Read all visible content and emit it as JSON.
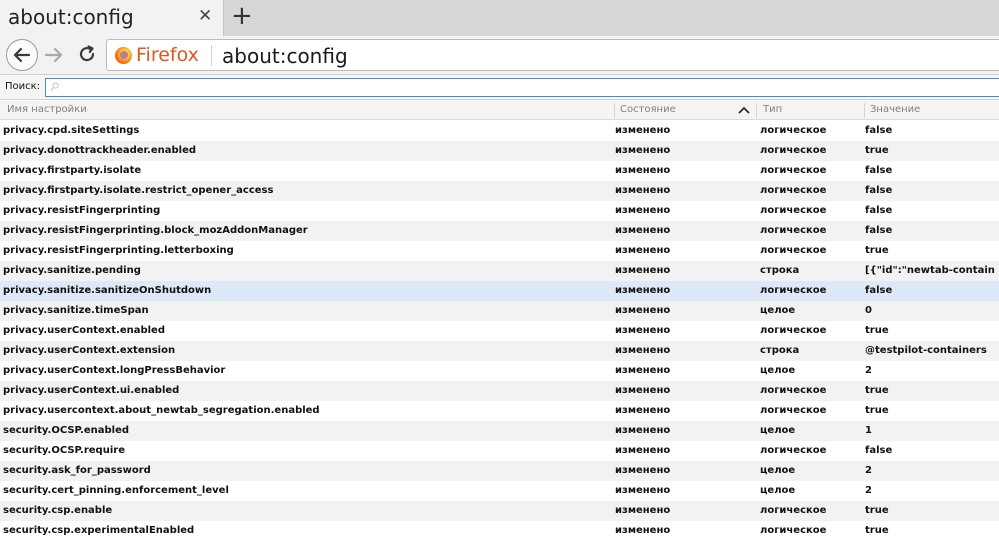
{
  "tab": {
    "title": "about:config",
    "close_glyph": "✕",
    "new_tab_glyph": "+"
  },
  "nav": {
    "back_icon": "back-arrow-icon",
    "forward_icon": "forward-arrow-icon",
    "reload_icon": "reload-icon",
    "identity_label": "Firefox",
    "url": "about:config"
  },
  "search": {
    "label": "Поиск:",
    "value": "",
    "icon": "search-icon"
  },
  "columns": {
    "name": "Имя настройки",
    "state": "Состояние",
    "type": "Тип",
    "value": "Значение"
  },
  "colors": {
    "selected_row": "#dde9f6",
    "search_border": "#3d8fd8",
    "identity": "#e0561b"
  },
  "rows": [
    {
      "name": "privacy.cpd.siteSettings",
      "state": "изменено",
      "type": "логическое",
      "value": "false"
    },
    {
      "name": "privacy.donottrackheader.enabled",
      "state": "изменено",
      "type": "логическое",
      "value": "true"
    },
    {
      "name": "privacy.firstparty.isolate",
      "state": "изменено",
      "type": "логическое",
      "value": "false"
    },
    {
      "name": "privacy.firstparty.isolate.restrict_opener_access",
      "state": "изменено",
      "type": "логическое",
      "value": "false"
    },
    {
      "name": "privacy.resistFingerprinting",
      "state": "изменено",
      "type": "логическое",
      "value": "false"
    },
    {
      "name": "privacy.resistFingerprinting.block_mozAddonManager",
      "state": "изменено",
      "type": "логическое",
      "value": "false"
    },
    {
      "name": "privacy.resistFingerprinting.letterboxing",
      "state": "изменено",
      "type": "логическое",
      "value": "true"
    },
    {
      "name": "privacy.sanitize.pending",
      "state": "изменено",
      "type": "строка",
      "value": "[{\"id\":\"newtab-contain"
    },
    {
      "name": "privacy.sanitize.sanitizeOnShutdown",
      "state": "изменено",
      "type": "логическое",
      "value": "false",
      "selected": true
    },
    {
      "name": "privacy.sanitize.timeSpan",
      "state": "изменено",
      "type": "целое",
      "value": "0"
    },
    {
      "name": "privacy.userContext.enabled",
      "state": "изменено",
      "type": "логическое",
      "value": "true"
    },
    {
      "name": "privacy.userContext.extension",
      "state": "изменено",
      "type": "строка",
      "value": "@testpilot-containers"
    },
    {
      "name": "privacy.userContext.longPressBehavior",
      "state": "изменено",
      "type": "целое",
      "value": "2"
    },
    {
      "name": "privacy.userContext.ui.enabled",
      "state": "изменено",
      "type": "логическое",
      "value": "true"
    },
    {
      "name": "privacy.usercontext.about_newtab_segregation.enabled",
      "state": "изменено",
      "type": "логическое",
      "value": "true"
    },
    {
      "name": "security.OCSP.enabled",
      "state": "изменено",
      "type": "целое",
      "value": "1"
    },
    {
      "name": "security.OCSP.require",
      "state": "изменено",
      "type": "логическое",
      "value": "false"
    },
    {
      "name": "security.ask_for_password",
      "state": "изменено",
      "type": "целое",
      "value": "2"
    },
    {
      "name": "security.cert_pinning.enforcement_level",
      "state": "изменено",
      "type": "целое",
      "value": "2"
    },
    {
      "name": "security.csp.enable",
      "state": "изменено",
      "type": "логическое",
      "value": "true"
    },
    {
      "name": "security.csp.experimentalEnabled",
      "state": "изменено",
      "type": "логическое",
      "value": "true"
    }
  ]
}
